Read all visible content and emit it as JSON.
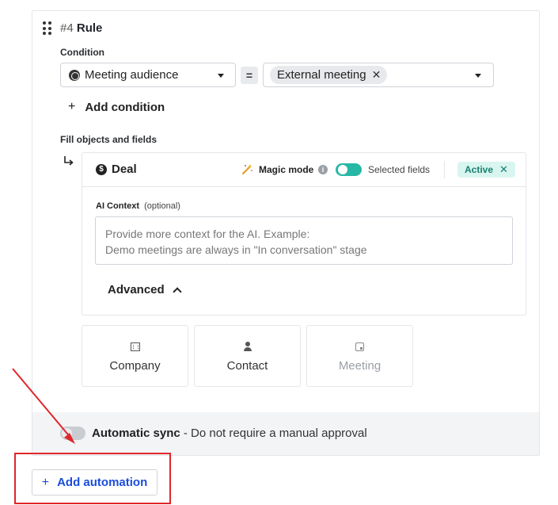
{
  "rule": {
    "number": "#4",
    "title": "Rule"
  },
  "condition": {
    "label": "Condition",
    "field": "Meeting audience",
    "operator": "=",
    "value_chip": "External meeting",
    "add_label": "Add condition"
  },
  "fill": {
    "label": "Fill objects and fields"
  },
  "deal": {
    "title": "Deal",
    "magic_mode": "Magic mode",
    "selected_fields": "Selected fields",
    "status": "Active",
    "ai_context_label": "AI Context",
    "ai_context_optional": "(optional)",
    "ai_context_placeholder": "Provide more context for the AI. Example:\nDemo meetings are always in \"In conversation\" stage",
    "advanced": "Advanced"
  },
  "objects": [
    {
      "name": "Company",
      "icon": "building-icon",
      "enabled": true
    },
    {
      "name": "Contact",
      "icon": "person-icon",
      "enabled": true
    },
    {
      "name": "Meeting",
      "icon": "calendar-icon",
      "enabled": false
    }
  ],
  "sync": {
    "title": "Automatic sync",
    "description": " - Do not require a manual approval",
    "enabled": false
  },
  "add_automation": "Add automation",
  "colors": {
    "accent_teal": "#27b8a5",
    "link_blue": "#1a4ddb",
    "annotation_red": "#e0262b"
  }
}
